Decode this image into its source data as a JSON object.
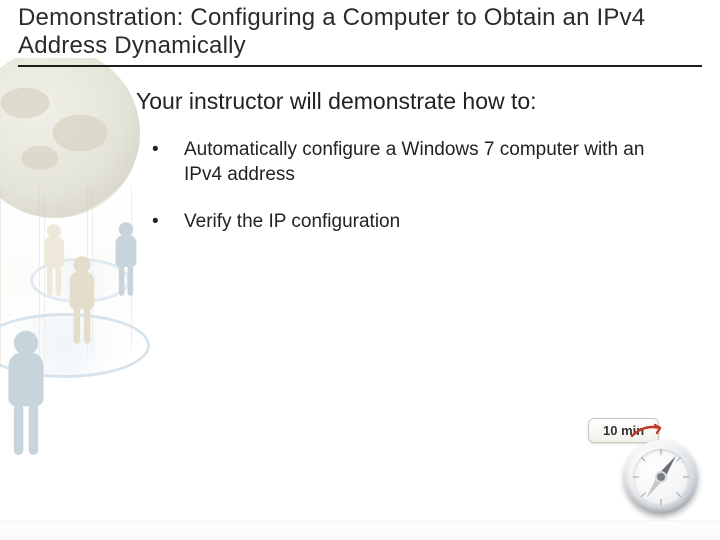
{
  "title": "Demonstration: Configuring a Computer to Obtain an IPv4 Address Dynamically",
  "intro": "Your instructor will demonstrate how to:",
  "bullets": [
    "Automatically configure a Windows 7 computer with an IPv4 address",
    "Verify the IP configuration"
  ],
  "timer": {
    "label": "10 min"
  }
}
